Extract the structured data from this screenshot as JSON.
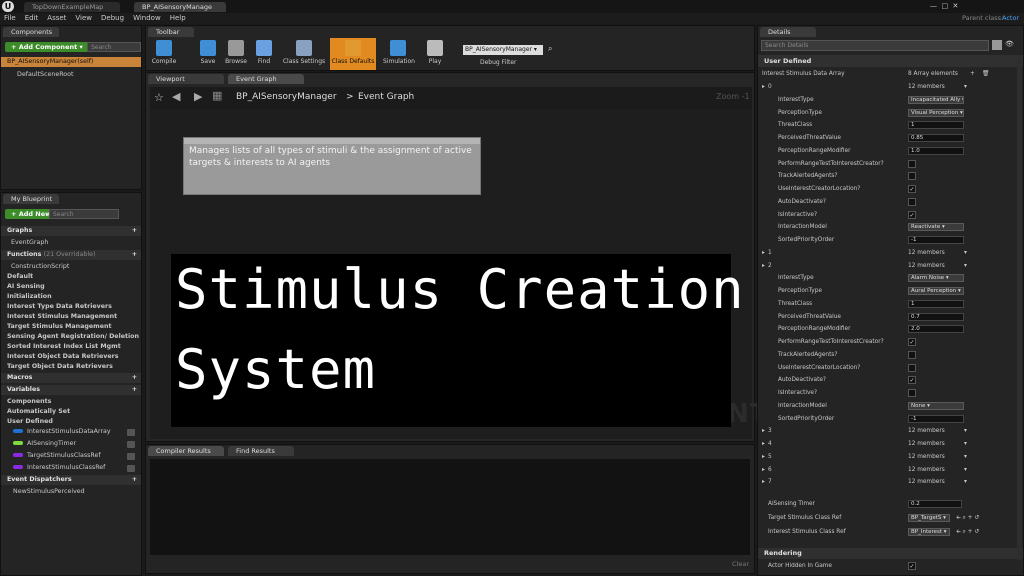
{
  "tabs": {
    "map": "TopDownExampleMap",
    "bp": "BP_AISensoryManage",
    "parent_class_label": "Parent class:",
    "parent_class": "Actor"
  },
  "menu": [
    "File",
    "Edit",
    "Asset",
    "View",
    "Debug",
    "Window",
    "Help"
  ],
  "components": {
    "tab": "Components",
    "add_button": "+ Add Component ▾",
    "search_placeholder": "Search",
    "items": [
      "BP_AISensoryManager(self)",
      "DefaultSceneRoot"
    ]
  },
  "mybp": {
    "tab": "My Blueprint",
    "add_button": "+ Add New ▾",
    "search_placeholder": "Search",
    "graphs_header": "Graphs",
    "event_graph": "EventGraph",
    "functions_header": "Functions",
    "functions_count": "(21 Overridable)",
    "functions": [
      "ConstructionScript",
      "Default",
      "AI Sensing",
      "Initialization",
      "Interest Type Data Retrievers",
      "Interest Stimulus Management",
      "Target Stimulus Management",
      "Sensing Agent Registration/ Deletion",
      "Sorted Interest Index List Mgmt",
      "Interest Object Data Retrievers",
      "Target Object Data Retrievers"
    ],
    "macros_header": "Macros",
    "variables_header": "Variables",
    "variable_groups": [
      "Components",
      "Automatically Set",
      "User Defined"
    ],
    "variables": [
      {
        "name": "InterestStimulusDataArray",
        "color": "#1e6fd6"
      },
      {
        "name": "AISensingTimer",
        "color": "#7ddc3a"
      },
      {
        "name": "TargetStimulusClassRef",
        "color": "#8a2be2"
      },
      {
        "name": "InterestStimulusClassRef",
        "color": "#8a2be2"
      }
    ],
    "dispatchers_header": "Event Dispatchers",
    "dispatchers": [
      "NewStimulusPerceived"
    ]
  },
  "toolbar": {
    "tab": "Toolbar",
    "items": [
      "Compile",
      "Save",
      "Browse",
      "Find",
      "Class Settings",
      "Class Defaults",
      "Simulation",
      "Play"
    ],
    "debug_object": "BP_AISensoryManager ▾",
    "debug_label": "Debug Filter"
  },
  "graph": {
    "tabs": [
      "Viewport",
      "Event Graph"
    ],
    "breadcrumb_bp": "BP_AISensoryManager",
    "breadcrumb_sep": ">",
    "breadcrumb_graph": "Event Graph",
    "zoom": "Zoom -1",
    "comment": "Manages lists of all types of stimuli & the assignment of active targets & interests to AI agents",
    "watermark": "BLUEPRINT",
    "overlay_line1": "Stimulus Creation",
    "overlay_line2": "System"
  },
  "bottom": {
    "tabs": [
      "Compiler Results",
      "Find Results"
    ],
    "clear": "Clear"
  },
  "details": {
    "tab": "Details",
    "search_placeholder": "Search Details",
    "category": "User Defined",
    "array_label": "Interest Stimulus Data Array",
    "array_value": "8 Array elements",
    "rows": [
      {
        "type": "idx",
        "label": "0",
        "value": "12 members"
      },
      {
        "type": "dd",
        "label": "InterestType",
        "value": "Incapacitated Ally ▾"
      },
      {
        "type": "dd",
        "label": "PerceptionType",
        "value": "Visual Perception ▾"
      },
      {
        "type": "num",
        "label": "ThreatClass",
        "value": "1"
      },
      {
        "type": "num",
        "label": "PerceivedThreatValue",
        "value": "0.85"
      },
      {
        "type": "num",
        "label": "PerceptionRangeModifier",
        "value": "1.0"
      },
      {
        "type": "chk",
        "label": "PerformRangeTestToInterestCreator?",
        "value": ""
      },
      {
        "type": "chk",
        "label": "TrackAlertedAgents?",
        "value": ""
      },
      {
        "type": "chk",
        "label": "UseInterestCreatorLocation?",
        "value": "✓"
      },
      {
        "type": "chk",
        "label": "AutoDeactivate?",
        "value": ""
      },
      {
        "type": "chk",
        "label": "IsInteractive?",
        "value": "✓"
      },
      {
        "type": "dd",
        "label": "InteractionModel",
        "value": "Reactivate ▾"
      },
      {
        "type": "num",
        "label": "SortedPriorityOrder",
        "value": "-1"
      },
      {
        "type": "idx",
        "label": "1",
        "value": "12 members"
      },
      {
        "type": "idx",
        "label": "2",
        "value": "12 members"
      },
      {
        "type": "dd",
        "label": "InterestType",
        "value": "Alarm Noise ▾"
      },
      {
        "type": "dd",
        "label": "PerceptionType",
        "value": "Aural Perception ▾"
      },
      {
        "type": "num",
        "label": "ThreatClass",
        "value": "1"
      },
      {
        "type": "num",
        "label": "PerceivedThreatValue",
        "value": "0.7"
      },
      {
        "type": "num",
        "label": "PerceptionRangeModifier",
        "value": "2.0"
      },
      {
        "type": "chk",
        "label": "PerformRangeTestToInterestCreator?",
        "value": "✓"
      },
      {
        "type": "chk",
        "label": "TrackAlertedAgents?",
        "value": ""
      },
      {
        "type": "chk",
        "label": "UseInterestCreatorLocation?",
        "value": ""
      },
      {
        "type": "chk",
        "label": "AutoDeactivate?",
        "value": "✓"
      },
      {
        "type": "chk",
        "label": "IsInteractive?",
        "value": ""
      },
      {
        "type": "dd",
        "label": "InteractionModel",
        "value": "None ▾"
      },
      {
        "type": "num",
        "label": "SortedPriorityOrder",
        "value": "-1"
      },
      {
        "type": "idx",
        "label": "3",
        "value": "12 members"
      },
      {
        "type": "idx",
        "label": "4",
        "value": "12 members"
      },
      {
        "type": "idx",
        "label": "5",
        "value": "12 members"
      },
      {
        "type": "idx",
        "label": "6",
        "value": "12 members"
      },
      {
        "type": "idx",
        "label": "7",
        "value": "12 members"
      }
    ],
    "timer_label": "AISensing Timer",
    "timer_value": "0.2",
    "target_label": "Target Stimulus Class Ref",
    "target_value": "BP_TargetS ▾",
    "interest_label": "Interest Stimulus Class Ref",
    "interest_value": "BP_Interest ▾",
    "rendering": "Rendering",
    "hidden_label": "Actor Hidden In Game"
  }
}
